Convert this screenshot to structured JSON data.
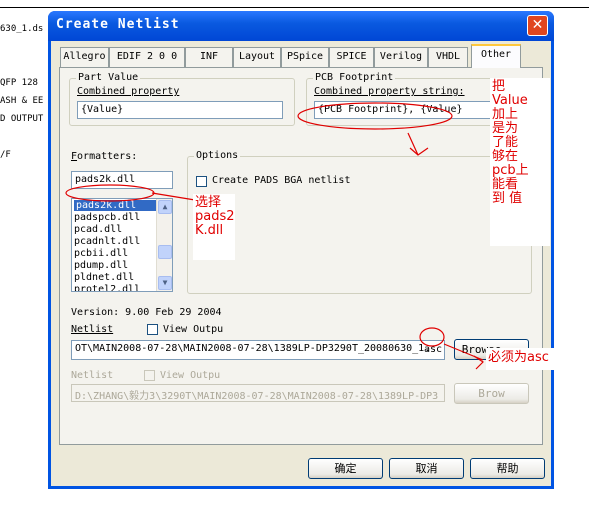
{
  "background": {
    "lines": [
      "630_1.ds",
      "QFP 128",
      "ASH & EE",
      "D OUTPUT",
      "/F"
    ]
  },
  "window": {
    "title": "Create Netlist",
    "close_glyph": "✕"
  },
  "tabs": [
    "Allegro",
    "EDIF 2 0 0",
    "INF",
    "Layout",
    "PSpice",
    "SPICE",
    "Verilog",
    "VHDL",
    "Other"
  ],
  "active_tab": "Other",
  "part_value": {
    "title": "Part Value",
    "label": "Combined property",
    "value": "{Value}"
  },
  "pcb_footprint": {
    "title": "PCB Footprint",
    "label": "Combined property string:",
    "value": "{PCB Footprint}, {Value}"
  },
  "formatters": {
    "label": "Formatters:",
    "current": "pads2k.dll",
    "items": [
      "pads2k.dll",
      "padspcb.dll",
      "pcad.dll",
      "pcadnlt.dll",
      "pcbii.dll",
      "pdump.dll",
      "pldnet.dll",
      "protel2.dll",
      "..."
    ],
    "selected_index": 0
  },
  "options": {
    "title": "Options",
    "checkbox_label": "Create PADS BGA netlist",
    "checked": false
  },
  "version": "Version: 9.00  Feb 29 2004",
  "netlist": {
    "label": "Netlist",
    "view_output": "View Outpu",
    "path": "OT\\MAIN2008-07-28\\MAIN2008-07-28\\1389LP-DP3290T_20080630_1.",
    "ext": "asc",
    "browse": "Browse..."
  },
  "netlist2": {
    "label": "Netlist",
    "view_output": "View Outpu",
    "path": "D:\\ZHANG\\毅力3\\3290T\\MAIN2008-07-28\\MAIN2008-07-28\\1389LP-DP3",
    "browse": "Brow"
  },
  "buttons": {
    "ok": "确定",
    "cancel": "取消",
    "help": "帮助"
  },
  "annotations": {
    "select": [
      "选择",
      "pads2",
      "K.dll"
    ],
    "note": [
      "把",
      "Value",
      "加上",
      "是为",
      "了能",
      "够在",
      "pcb上",
      "能看",
      "到 值"
    ],
    "must": "必须为asc"
  },
  "colors": {
    "annotation": "#e00000",
    "title_bar": "#0054e3",
    "selection": "#316ac5"
  }
}
